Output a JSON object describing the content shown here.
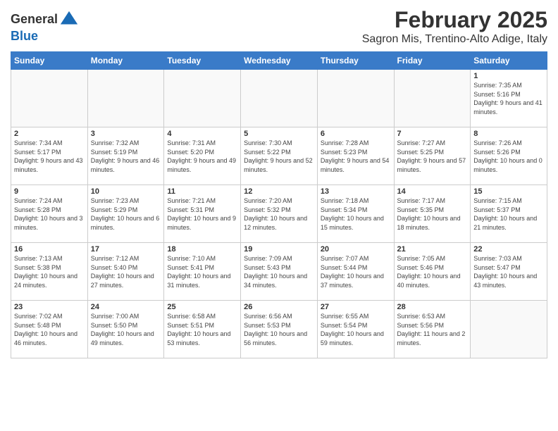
{
  "logo": {
    "line1": "General",
    "line2": "Blue"
  },
  "title": "February 2025",
  "location": "Sagron Mis, Trentino-Alto Adige, Italy",
  "days_of_week": [
    "Sunday",
    "Monday",
    "Tuesday",
    "Wednesday",
    "Thursday",
    "Friday",
    "Saturday"
  ],
  "weeks": [
    [
      {
        "day": "",
        "info": ""
      },
      {
        "day": "",
        "info": ""
      },
      {
        "day": "",
        "info": ""
      },
      {
        "day": "",
        "info": ""
      },
      {
        "day": "",
        "info": ""
      },
      {
        "day": "",
        "info": ""
      },
      {
        "day": "1",
        "info": "Sunrise: 7:35 AM\nSunset: 5:16 PM\nDaylight: 9 hours\nand 41 minutes."
      }
    ],
    [
      {
        "day": "2",
        "info": "Sunrise: 7:34 AM\nSunset: 5:17 PM\nDaylight: 9 hours\nand 43 minutes."
      },
      {
        "day": "3",
        "info": "Sunrise: 7:32 AM\nSunset: 5:19 PM\nDaylight: 9 hours\nand 46 minutes."
      },
      {
        "day": "4",
        "info": "Sunrise: 7:31 AM\nSunset: 5:20 PM\nDaylight: 9 hours\nand 49 minutes."
      },
      {
        "day": "5",
        "info": "Sunrise: 7:30 AM\nSunset: 5:22 PM\nDaylight: 9 hours\nand 52 minutes."
      },
      {
        "day": "6",
        "info": "Sunrise: 7:28 AM\nSunset: 5:23 PM\nDaylight: 9 hours\nand 54 minutes."
      },
      {
        "day": "7",
        "info": "Sunrise: 7:27 AM\nSunset: 5:25 PM\nDaylight: 9 hours\nand 57 minutes."
      },
      {
        "day": "8",
        "info": "Sunrise: 7:26 AM\nSunset: 5:26 PM\nDaylight: 10 hours\nand 0 minutes."
      }
    ],
    [
      {
        "day": "9",
        "info": "Sunrise: 7:24 AM\nSunset: 5:28 PM\nDaylight: 10 hours\nand 3 minutes."
      },
      {
        "day": "10",
        "info": "Sunrise: 7:23 AM\nSunset: 5:29 PM\nDaylight: 10 hours\nand 6 minutes."
      },
      {
        "day": "11",
        "info": "Sunrise: 7:21 AM\nSunset: 5:31 PM\nDaylight: 10 hours\nand 9 minutes."
      },
      {
        "day": "12",
        "info": "Sunrise: 7:20 AM\nSunset: 5:32 PM\nDaylight: 10 hours\nand 12 minutes."
      },
      {
        "day": "13",
        "info": "Sunrise: 7:18 AM\nSunset: 5:34 PM\nDaylight: 10 hours\nand 15 minutes."
      },
      {
        "day": "14",
        "info": "Sunrise: 7:17 AM\nSunset: 5:35 PM\nDaylight: 10 hours\nand 18 minutes."
      },
      {
        "day": "15",
        "info": "Sunrise: 7:15 AM\nSunset: 5:37 PM\nDaylight: 10 hours\nand 21 minutes."
      }
    ],
    [
      {
        "day": "16",
        "info": "Sunrise: 7:13 AM\nSunset: 5:38 PM\nDaylight: 10 hours\nand 24 minutes."
      },
      {
        "day": "17",
        "info": "Sunrise: 7:12 AM\nSunset: 5:40 PM\nDaylight: 10 hours\nand 27 minutes."
      },
      {
        "day": "18",
        "info": "Sunrise: 7:10 AM\nSunset: 5:41 PM\nDaylight: 10 hours\nand 31 minutes."
      },
      {
        "day": "19",
        "info": "Sunrise: 7:09 AM\nSunset: 5:43 PM\nDaylight: 10 hours\nand 34 minutes."
      },
      {
        "day": "20",
        "info": "Sunrise: 7:07 AM\nSunset: 5:44 PM\nDaylight: 10 hours\nand 37 minutes."
      },
      {
        "day": "21",
        "info": "Sunrise: 7:05 AM\nSunset: 5:46 PM\nDaylight: 10 hours\nand 40 minutes."
      },
      {
        "day": "22",
        "info": "Sunrise: 7:03 AM\nSunset: 5:47 PM\nDaylight: 10 hours\nand 43 minutes."
      }
    ],
    [
      {
        "day": "23",
        "info": "Sunrise: 7:02 AM\nSunset: 5:48 PM\nDaylight: 10 hours\nand 46 minutes."
      },
      {
        "day": "24",
        "info": "Sunrise: 7:00 AM\nSunset: 5:50 PM\nDaylight: 10 hours\nand 49 minutes."
      },
      {
        "day": "25",
        "info": "Sunrise: 6:58 AM\nSunset: 5:51 PM\nDaylight: 10 hours\nand 53 minutes."
      },
      {
        "day": "26",
        "info": "Sunrise: 6:56 AM\nSunset: 5:53 PM\nDaylight: 10 hours\nand 56 minutes."
      },
      {
        "day": "27",
        "info": "Sunrise: 6:55 AM\nSunset: 5:54 PM\nDaylight: 10 hours\nand 59 minutes."
      },
      {
        "day": "28",
        "info": "Sunrise: 6:53 AM\nSunset: 5:56 PM\nDaylight: 11 hours\nand 2 minutes."
      },
      {
        "day": "",
        "info": ""
      }
    ]
  ]
}
